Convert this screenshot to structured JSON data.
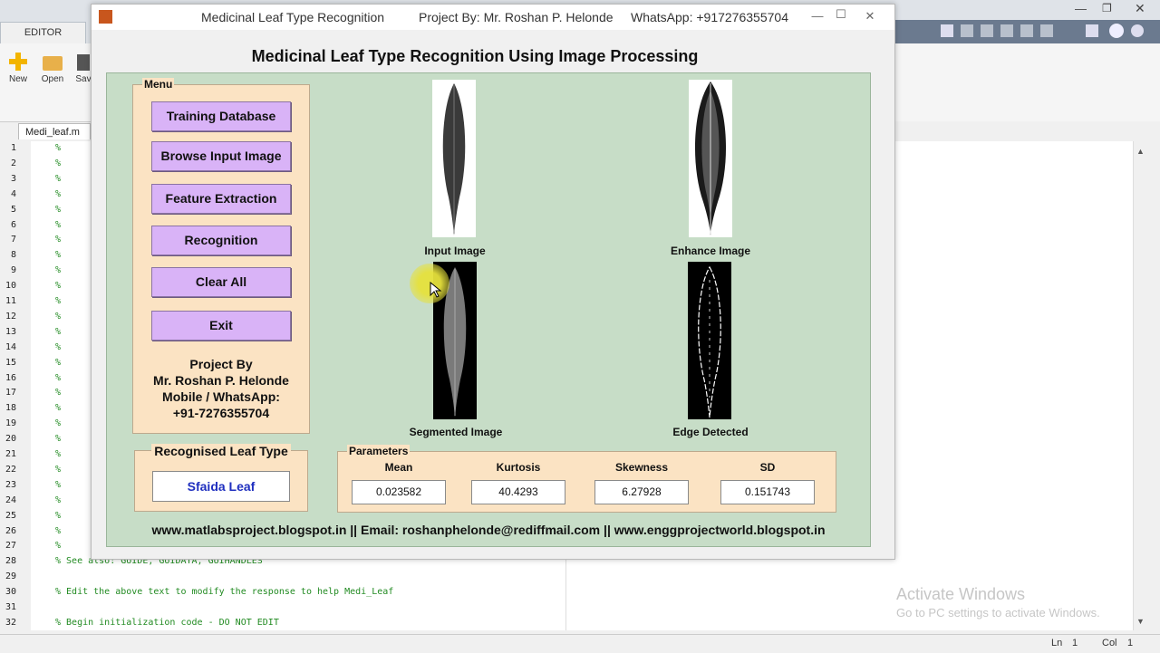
{
  "matlab": {
    "editor_tab": "EDITOR",
    "toolbar": {
      "new": "New",
      "open": "Open",
      "save": "Sav"
    },
    "file_tab": "Medi_leaf.m",
    "code_lines": [
      {
        "n": "1",
        "text": "%"
      },
      {
        "n": "2",
        "text": "%"
      },
      {
        "n": "3",
        "text": "%"
      },
      {
        "n": "4",
        "text": "%"
      },
      {
        "n": "5",
        "text": "%"
      },
      {
        "n": "6",
        "text": "%"
      },
      {
        "n": "7",
        "text": "%"
      },
      {
        "n": "8",
        "text": "%"
      },
      {
        "n": "9",
        "text": "%"
      },
      {
        "n": "10",
        "text": "%"
      },
      {
        "n": "11",
        "text": "%"
      },
      {
        "n": "12",
        "text": "%"
      },
      {
        "n": "13",
        "text": "%"
      },
      {
        "n": "14",
        "text": "%"
      },
      {
        "n": "15",
        "text": "%"
      },
      {
        "n": "16",
        "text": "%"
      },
      {
        "n": "17",
        "text": "%"
      },
      {
        "n": "18",
        "text": "%"
      },
      {
        "n": "19",
        "text": "%"
      },
      {
        "n": "20",
        "text": "%"
      },
      {
        "n": "21",
        "text": "%"
      },
      {
        "n": "22",
        "text": "%"
      },
      {
        "n": "23",
        "text": "%"
      },
      {
        "n": "24",
        "text": "%"
      },
      {
        "n": "25",
        "text": "%"
      },
      {
        "n": "26",
        "text": "%"
      },
      {
        "n": "27",
        "text": "%"
      },
      {
        "n": "28",
        "text": "% See also: GUIDE, GUIDATA, GUIHANDLES"
      },
      {
        "n": "29",
        "text": ""
      },
      {
        "n": "30",
        "text": "% Edit the above text to modify the response to help Medi_Leaf"
      },
      {
        "n": "31",
        "text": ""
      },
      {
        "n": "32",
        "text": "% Begin initialization code - DO NOT EDIT"
      }
    ],
    "status": {
      "ln_label": "Ln",
      "ln_value": "1",
      "col_label": "Col",
      "col_value": "1"
    },
    "watermark": {
      "title": "Activate Windows",
      "subtitle": "Go to PC settings to activate Windows."
    }
  },
  "figure": {
    "title_segments": {
      "app": "Medicinal Leaf Type Recognition",
      "project": "Project By: Mr. Roshan P. Helonde",
      "whatsapp": "WhatsApp: +917276355704"
    },
    "window_controls": {
      "minimize": "—",
      "maximize": "☐",
      "close": "✕"
    },
    "heading": "Medicinal Leaf Type Recognition Using Image Processing",
    "menu": {
      "title": "Menu",
      "buttons": [
        "Training Database",
        "Browse Input Image",
        "Feature Extraction",
        "Recognition",
        "Clear All",
        "Exit"
      ],
      "project_info": [
        "Project By",
        "Mr. Roshan P. Helonde",
        "Mobile / WhatsApp:",
        "+91-7276355704"
      ]
    },
    "images": {
      "input": "Input Image",
      "enhance": "Enhance Image",
      "segmented": "Segmented Image",
      "edge": "Edge Detected"
    },
    "result": {
      "title": "Recognised Leaf Type",
      "value": "Sfaida Leaf"
    },
    "parameters": {
      "title": "Parameters",
      "items": [
        {
          "label": "Mean",
          "value": "0.023582"
        },
        {
          "label": "Kurtosis",
          "value": "40.4293"
        },
        {
          "label": "Skewness",
          "value": "6.27928"
        },
        {
          "label": "SD",
          "value": "0.151743"
        }
      ]
    },
    "footer": "www.matlabsproject.blogspot.in || Email: roshanphelonde@rediffmail.com || www.enggprojectworld.blogspot.in"
  },
  "colors": {
    "panel_green": "#c7ddc7",
    "peach": "#fbe3c3",
    "button_purple": "#d9b3f7",
    "result_blue": "#1f2fbf"
  }
}
